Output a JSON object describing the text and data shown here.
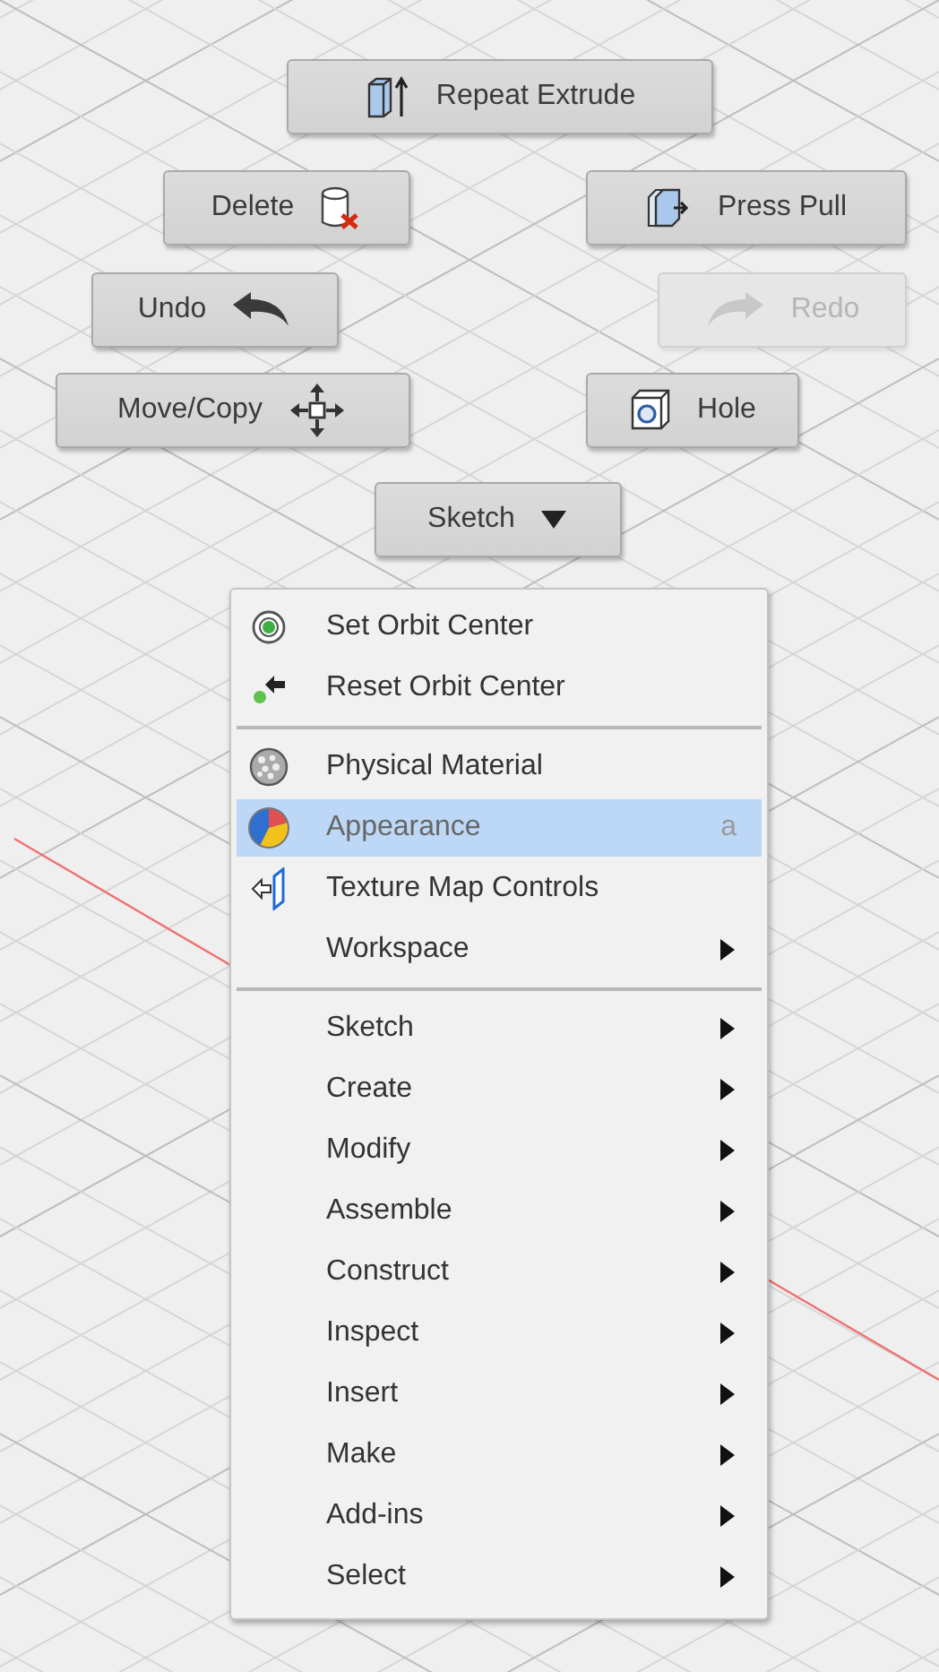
{
  "marking_menu": {
    "buttons": [
      {
        "label": "Repeat Extrude",
        "disabled": false
      },
      {
        "label": "Delete",
        "disabled": false
      },
      {
        "label": "Press Pull",
        "disabled": false
      },
      {
        "label": "Undo",
        "disabled": false
      },
      {
        "label": "Redo",
        "disabled": true
      },
      {
        "label": "Move/Copy",
        "disabled": false
      },
      {
        "label": "Hole",
        "disabled": false
      }
    ],
    "dropdown": {
      "label": "Sketch"
    }
  },
  "context_menu": {
    "groups": [
      [
        {
          "label": "Set Orbit Center",
          "submenu": false,
          "selected": false
        },
        {
          "label": "Reset Orbit Center",
          "submenu": false,
          "selected": false
        }
      ],
      [
        {
          "label": "Physical Material",
          "submenu": false,
          "selected": false
        },
        {
          "label": "Appearance",
          "shortcut": "a",
          "submenu": false,
          "selected": true
        },
        {
          "label": "Texture Map Controls",
          "submenu": false,
          "selected": false
        },
        {
          "label": "Workspace",
          "submenu": true,
          "selected": false
        }
      ],
      [
        {
          "label": "Sketch",
          "submenu": true,
          "selected": false
        },
        {
          "label": "Create",
          "submenu": true,
          "selected": false
        },
        {
          "label": "Modify",
          "submenu": true,
          "selected": false
        },
        {
          "label": "Assemble",
          "submenu": true,
          "selected": false
        },
        {
          "label": "Construct",
          "submenu": true,
          "selected": false
        },
        {
          "label": "Inspect",
          "submenu": true,
          "selected": false
        },
        {
          "label": "Insert",
          "submenu": true,
          "selected": false
        },
        {
          "label": "Make",
          "submenu": true,
          "selected": false
        },
        {
          "label": "Add-ins",
          "submenu": true,
          "selected": false
        },
        {
          "label": "Select",
          "submenu": true,
          "selected": false
        }
      ]
    ]
  }
}
